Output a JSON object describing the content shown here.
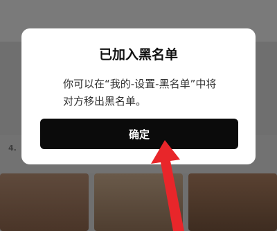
{
  "dialog": {
    "title": "已加入黑名单",
    "message": "你可以在“我的-设置-黑名单”中将对方移出黑名单。",
    "confirm_label": "确定"
  },
  "background": {
    "side_text": "4."
  },
  "colors": {
    "dialog_bg": "#ffffff",
    "button_bg": "#0b0b0b",
    "button_text": "#ffffff",
    "arrow": "#e8262a",
    "overlay": "#6f6f6f"
  },
  "icons": {
    "arrow": "red-pointer-arrow"
  }
}
